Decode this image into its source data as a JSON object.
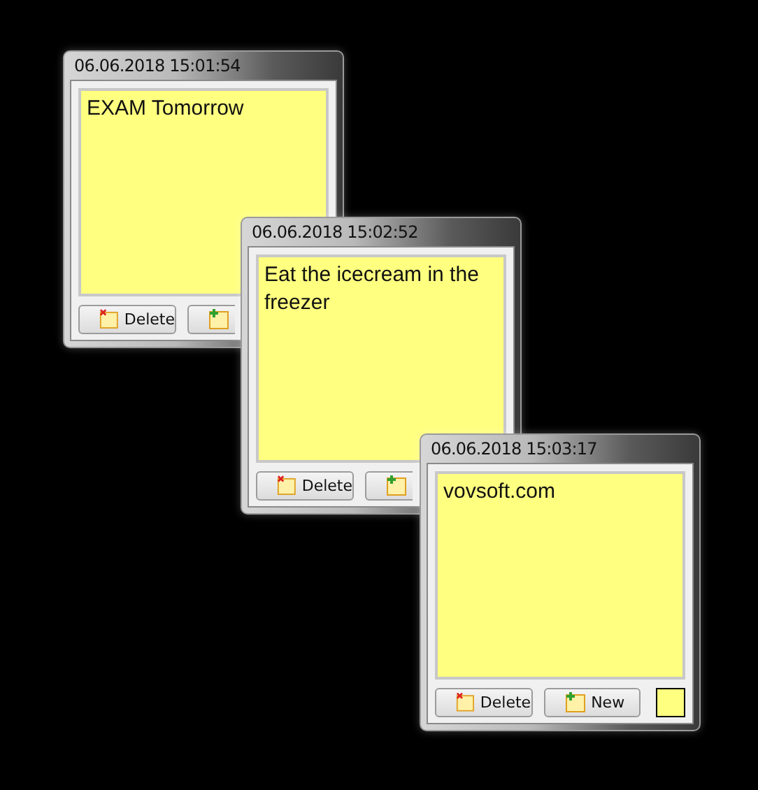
{
  "notes": [
    {
      "title": "06.06.2018 15:01:54",
      "text": "EXAM Tomorrow",
      "buttons": [
        {
          "kind": "delete",
          "label": "Delete"
        },
        {
          "kind": "new"
        }
      ]
    },
    {
      "title": "06.06.2018 15:02:52",
      "text": "Eat the icecream in the freezer",
      "buttons": [
        {
          "kind": "delete",
          "label": "Delete"
        },
        {
          "kind": "new"
        }
      ]
    },
    {
      "title": "06.06.2018 15:03:17",
      "text": "vovsoft.com",
      "buttons": [
        {
          "kind": "delete",
          "label": "Delete"
        },
        {
          "kind": "new",
          "label": "New"
        }
      ],
      "swatch": {
        "color": "#ffff80"
      }
    }
  ]
}
